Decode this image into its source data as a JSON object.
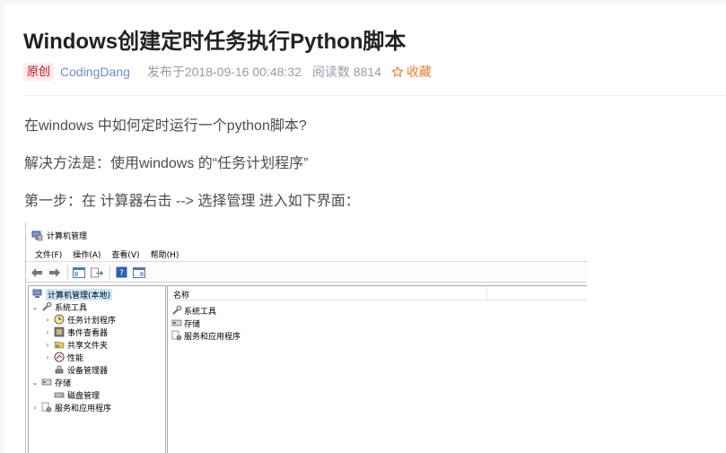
{
  "article": {
    "title": "Windows创建定时任务执行Python脚本",
    "badge": "原创",
    "author": "CodingDang",
    "posted": "发布于2018-09-16 00:48:32",
    "reads": "阅读数 8814",
    "favorite": "收藏",
    "paragraphs": [
      "在windows 中如何定时运行一个python脚本?",
      "解决方法是：使用windows 的“任务计划程序”",
      "第一步：在 计算器右击 --> 选择管理 进入如下界面："
    ]
  },
  "screenshot": {
    "window_title": "计算机管理",
    "menus": [
      "文件(F)",
      "操作(A)",
      "查看(V)",
      "帮助(H)"
    ],
    "tree": {
      "root": "计算机管理(本地)",
      "system_tools": "系统工具",
      "task_scheduler": "任务计划程序",
      "event_viewer": "事件查看器",
      "shared_folders": "共享文件夹",
      "performance": "性能",
      "device_manager": "设备管理器",
      "storage": "存储",
      "disk_management": "磁盘管理",
      "services_apps": "服务和应用程序"
    },
    "list_header": "名称",
    "list_items": [
      "系统工具",
      "存储",
      "服务和应用程序"
    ]
  },
  "colors": {
    "badge_bg": "#fdeeee",
    "badge_text": "#ca0c16",
    "author": "#6b8cce",
    "favorite": "#ef7d2c",
    "title": "#222226"
  }
}
